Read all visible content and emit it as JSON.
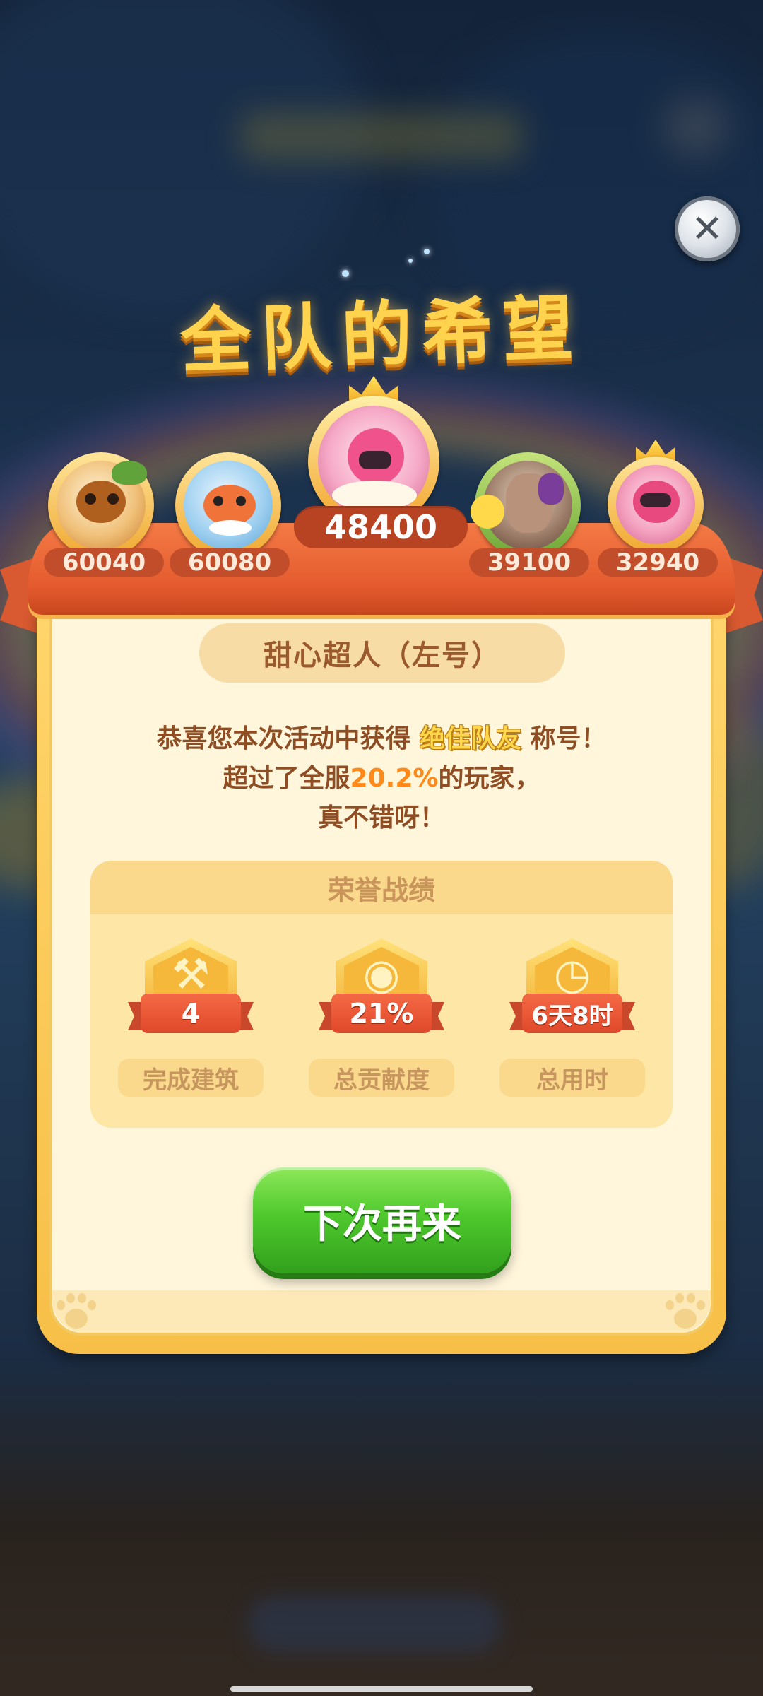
{
  "dialog": {
    "title": "全队的希望",
    "close_icon": "✕"
  },
  "team": {
    "main_score": "48400",
    "members": [
      {
        "score": "60040"
      },
      {
        "score": "60080"
      },
      {
        "score": "39100"
      },
      {
        "score": "32940"
      }
    ]
  },
  "player": {
    "name": "甜心超人（左号）"
  },
  "message": {
    "line1_prefix": "恭喜您本次活动中获得",
    "title_award": "绝佳队友",
    "line1_suffix": "称号！",
    "line2_prefix": "超过了全服",
    "percent": "20.2%",
    "line2_suffix": "的玩家，",
    "line3": "真不错呀！"
  },
  "honor": {
    "title": "荣誉战绩",
    "stats": [
      {
        "value": "4",
        "label": "完成建筑",
        "icon": "shovel-icon"
      },
      {
        "value": "21%",
        "label": "总贡献度",
        "icon": "medal-icon"
      },
      {
        "value": "6天8时",
        "label": "总用时",
        "icon": "clock-icon"
      }
    ]
  },
  "actions": {
    "next_label": "下次再来"
  },
  "colors": {
    "ribbon": "#e45a2e",
    "panel": "#fff6dc",
    "button_green": "#4fc92d",
    "title_yellow": "#ffd34e"
  }
}
